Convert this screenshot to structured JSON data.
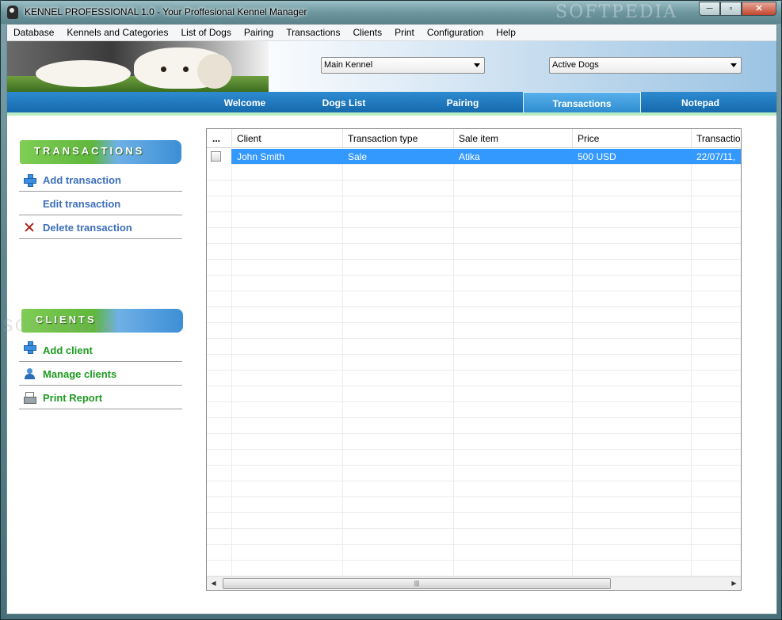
{
  "window": {
    "title": "KENNEL PROFESSIONAL 1.0 - Your Proffesional Kennel Manager",
    "minimize": "─",
    "maximize": "▫",
    "close": "✕"
  },
  "menu": [
    "Database",
    "Kennels and Categories",
    "List of Dogs",
    "Pairing",
    "Transactions",
    "Clients",
    "Print",
    "Configuration",
    "Help"
  ],
  "selectors": {
    "kennel": "Main Kennel",
    "dog_filter": "Active Dogs"
  },
  "tabs": [
    {
      "label": "Welcome",
      "active": false
    },
    {
      "label": "Dogs List",
      "active": false
    },
    {
      "label": "Pairing",
      "active": false
    },
    {
      "label": "Transactions",
      "active": true
    },
    {
      "label": "Notepad",
      "active": false
    }
  ],
  "sidebar": {
    "transactions_header": "TRANSACTIONS",
    "transactions": [
      {
        "label": "Add transaction",
        "icon": "plus-icon"
      },
      {
        "label": "Edit transaction",
        "icon": ""
      },
      {
        "label": "Delete transaction",
        "icon": "x-icon"
      }
    ],
    "clients_header": "CLIENTS",
    "clients": [
      {
        "label": "Add client",
        "icon": "plus-icon"
      },
      {
        "label": "Manage clients",
        "icon": "user-icon"
      },
      {
        "label": "Print Report",
        "icon": "printer-icon"
      }
    ]
  },
  "grid": {
    "columns": [
      "...",
      "Client",
      "Transaction type",
      "Sale item",
      "Price",
      "Transaction"
    ],
    "rows": [
      {
        "selected": true,
        "cells": [
          "John Smith",
          "Sale",
          "Atika",
          "500 USD",
          "22/07/11,"
        ]
      }
    ],
    "scroll_grip": "|||"
  },
  "watermarks": [
    "SOFTPEDIA",
    "SOFTPEDIA"
  ],
  "colors": {
    "tab_bar": "#1669ad",
    "selection": "#3399ff",
    "link_blue": "#3d6fb9",
    "link_green": "#1f9a22"
  }
}
